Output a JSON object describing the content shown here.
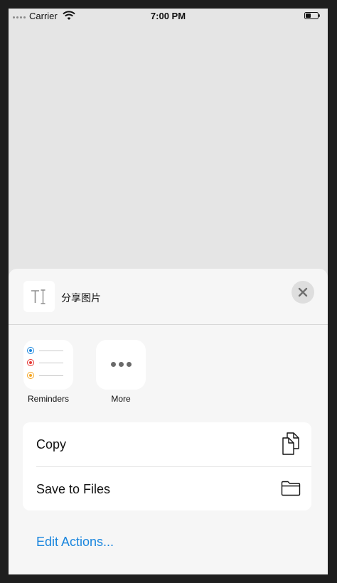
{
  "status_bar": {
    "carrier": "Carrier",
    "time": "7:00 PM"
  },
  "share_sheet": {
    "title": "分享图片",
    "thumbnail_icon": "text-format-icon",
    "apps": [
      {
        "label": "Reminders",
        "icon": "reminders-icon"
      },
      {
        "label": "More",
        "icon": "more-icon"
      }
    ],
    "actions": [
      {
        "label": "Copy",
        "icon": "copy-icon"
      },
      {
        "label": "Save to Files",
        "icon": "folder-icon"
      }
    ],
    "edit_actions_label": "Edit Actions...",
    "colors": {
      "link": "#1a86de",
      "reminder_dots": [
        "#1a86de",
        "#e53935",
        "#f5a623"
      ]
    }
  }
}
